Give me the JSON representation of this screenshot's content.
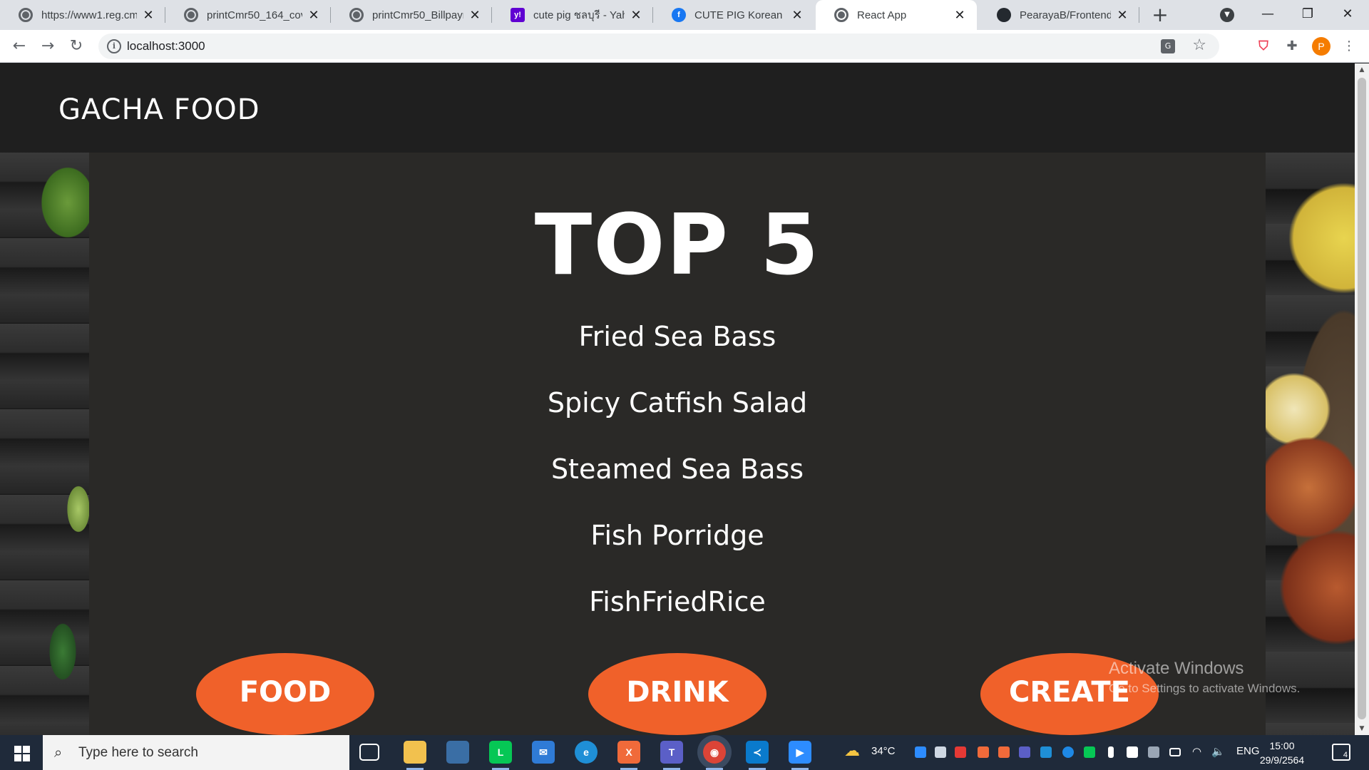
{
  "browser": {
    "tabs": [
      {
        "title": "https://www1.reg.cmu.ac.th",
        "icon": "globe-icon"
      },
      {
        "title": "printCmr50_164_covid",
        "icon": "globe-icon"
      },
      {
        "title": "printCmr50_Billpayment",
        "icon": "globe-icon"
      },
      {
        "title": "cute pig ชลบุรี - Yahoo",
        "icon": "yahoo-icon",
        "badge": "y!"
      },
      {
        "title": "CUTE PIG Korean BBQ",
        "icon": "facebook-icon",
        "badge": "f"
      },
      {
        "title": "React App",
        "icon": "globe-icon",
        "active": true
      },
      {
        "title": "PearayaB/FrontendProject",
        "icon": "github-icon"
      }
    ],
    "close_glyph": "✕",
    "new_tab_glyph": "+",
    "window_controls": {
      "minimize": "—",
      "restore": "❐",
      "close": "✕"
    },
    "url": "localhost:3000",
    "profile_initial": "P"
  },
  "site": {
    "brand": "GACHA FOOD",
    "heading": "TOP 5",
    "top_items": [
      "Fried Sea Bass",
      "Spicy Catfish Salad",
      "Steamed Sea Bass",
      "Fish Porridge",
      "FishFriedRice"
    ],
    "buttons": {
      "food": "FOOD",
      "drink": "DRINK",
      "create": "CREATE"
    },
    "accent_color": "#f0612a"
  },
  "watermark": {
    "title": "Activate Windows",
    "subtitle": "Go to Settings to activate Windows."
  },
  "taskbar": {
    "search_placeholder": "Type here to search",
    "weather": "34°C",
    "language": "ENG",
    "time": "15:00",
    "date": "29/9/2564",
    "notification_count": "4"
  }
}
